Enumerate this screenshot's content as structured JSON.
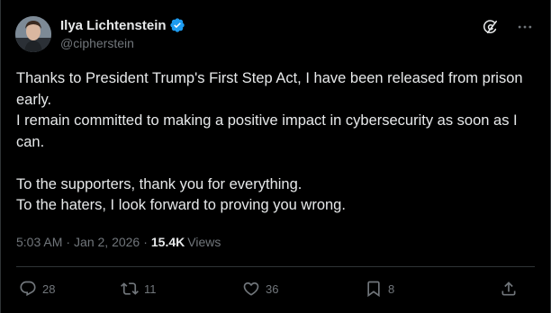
{
  "author": {
    "name": "Ilya Lichtenstein",
    "handle": "@cipherstein"
  },
  "tweet": {
    "lines": [
      "Thanks to President Trump's First Step Act, I have been released from prison early.",
      "I remain committed to making a positive impact in cybersecurity as soon as I can.",
      "To the supporters, thank you for everything.",
      "To the haters, I look forward to proving you wrong."
    ]
  },
  "meta": {
    "time": "5:03 AM",
    "separator": "·",
    "date": "Jan 2, 2026",
    "views_count": "15.4K",
    "views_label": "Views"
  },
  "actions": {
    "replies": "28",
    "reposts": "11",
    "likes": "36",
    "bookmarks": "8"
  },
  "colors": {
    "background": "#000000",
    "text": "#e7e9ea",
    "muted": "#71767b",
    "verified": "#1d9bf0",
    "border": "#2f3336"
  },
  "icons": {
    "verified": "verified-badge-icon",
    "grok": "grok-icon",
    "more": "more-icon",
    "reply": "reply-icon",
    "repost": "repost-icon",
    "like": "heart-icon",
    "bookmark": "bookmark-icon",
    "share": "share-icon"
  }
}
